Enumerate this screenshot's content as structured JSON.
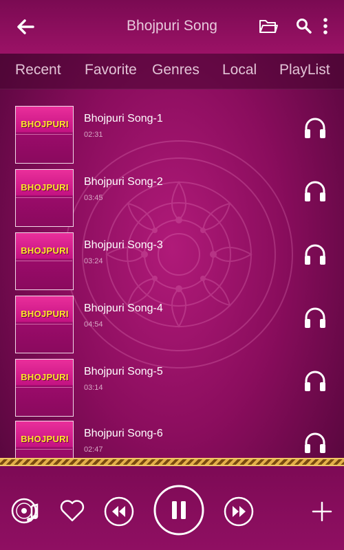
{
  "header": {
    "title": "Bhojpuri Song",
    "back_icon": "back-arrow-icon",
    "folder_icon": "folder-icon",
    "search_icon": "search-icon",
    "more_icon": "more-vertical-icon"
  },
  "tabs": [
    {
      "label": "Recent"
    },
    {
      "label": "Favorite"
    },
    {
      "label": "Genres"
    },
    {
      "label": "Local"
    },
    {
      "label": "PlayList"
    }
  ],
  "songs": [
    {
      "title": "Bhojpuri Song-1",
      "duration": "02:31",
      "thumb_text": "BHOJPURI"
    },
    {
      "title": "Bhojpuri Song-2",
      "duration": "03:45",
      "thumb_text": "BHOJPURI"
    },
    {
      "title": "Bhojpuri Song-3",
      "duration": "03:24",
      "thumb_text": "BHOJPURI"
    },
    {
      "title": "Bhojpuri Song-4",
      "duration": "04:54",
      "thumb_text": "BHOJPURI"
    },
    {
      "title": "Bhojpuri Song-5",
      "duration": "03:14",
      "thumb_text": "BHOJPURI"
    },
    {
      "title": "Bhojpuri Song-6",
      "duration": "02:47",
      "thumb_text": "BHOJPURI"
    }
  ],
  "player": {
    "icons": [
      "music-disc-icon",
      "heart-icon",
      "rewind-icon",
      "pause-icon",
      "fast-forward-icon",
      "plus-icon"
    ]
  },
  "colors": {
    "background": "#8a0d5d",
    "header": "#7a0a52",
    "accent_gold": "#e4b04a",
    "thumb_text": "#ffe82a"
  }
}
